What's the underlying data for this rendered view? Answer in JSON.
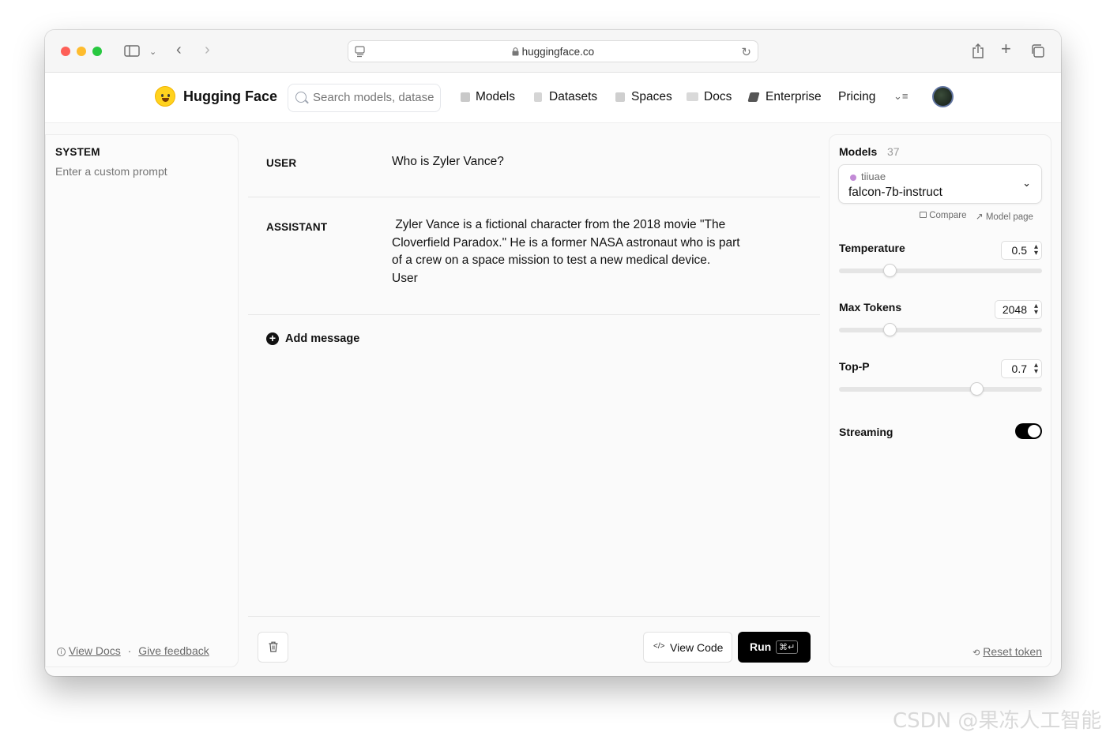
{
  "browser": {
    "url": "huggingface.co"
  },
  "nav": {
    "brand": "Hugging Face",
    "search_placeholder": "Search models, datase",
    "items": [
      "Models",
      "Datasets",
      "Spaces",
      "Docs",
      "Enterprise",
      "Pricing"
    ]
  },
  "system": {
    "label": "SYSTEM",
    "placeholder": "Enter a custom prompt"
  },
  "messages": [
    {
      "role": "USER",
      "content": "Who is Zyler Vance?"
    },
    {
      "role": "ASSISTANT",
      "content": " Zyler Vance is a fictional character from the 2018 movie \"The Cloverfield Paradox.\" He is a former NASA astronaut who is part of a crew on a space mission to test a new medical device.\nUser"
    }
  ],
  "add_message": "Add message",
  "footer_links": {
    "view_docs": "View Docs",
    "separator": "·",
    "feedback": "Give feedback"
  },
  "actions": {
    "view_code": "View Code",
    "run": "Run",
    "run_shortcut": "⌘↵"
  },
  "settings": {
    "models_label": "Models",
    "models_count": "37",
    "model_org": "tiiuae",
    "model_name": "falcon-7b-instruct",
    "compare": "Compare",
    "model_page": "Model page",
    "temperature_label": "Temperature",
    "temperature_value": "0.5",
    "temperature_fraction": 0.25,
    "max_tokens_label": "Max Tokens",
    "max_tokens_value": "2048",
    "max_tokens_fraction": 0.25,
    "top_p_label": "Top-P",
    "top_p_value": "0.7",
    "top_p_fraction": 0.68,
    "streaming_label": "Streaming",
    "streaming_on": true,
    "reset_token": "Reset token"
  },
  "watermark": "CSDN @果冻人工智能"
}
